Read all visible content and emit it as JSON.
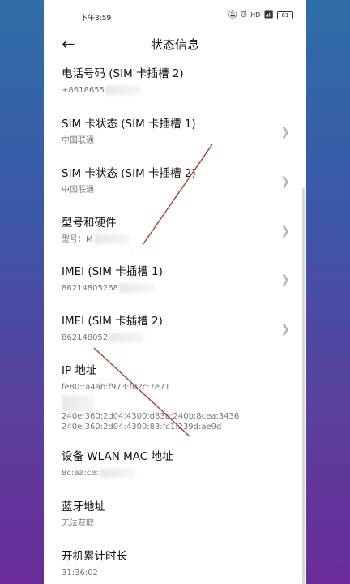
{
  "status_bar": {
    "time": "下午3:59",
    "icons": [
      "mute-icon",
      "alarm-icon",
      "hd-icon",
      "wifi-icon"
    ],
    "battery": "61"
  },
  "header": {
    "back_icon": "arrow-left-icon",
    "title": "状态信息"
  },
  "items": [
    {
      "label": "电话号码 (SIM 卡插槽 2)",
      "value": "+8618655",
      "chevron": false
    },
    {
      "label": "SIM 卡状态 (SIM 卡插槽 1)",
      "value": "中国联通",
      "chevron": true
    },
    {
      "label": "SIM 卡状态 (SIM 卡插槽 2)",
      "value": "中国联通",
      "chevron": true
    },
    {
      "label": "型号和硬件",
      "value": "型号：M",
      "chevron": true
    },
    {
      "label": "IMEI (SIM 卡插槽 1)",
      "value": "86214805268",
      "chevron": true
    },
    {
      "label": "IMEI (SIM 卡插槽 2)",
      "value": "862148052",
      "chevron": true
    },
    {
      "label": "IP 地址",
      "value_lines": [
        "fe80::a4ab:f973:f02c:7e71",
        "240e:360:2d04:4300:d83b:240b:8cea:3436",
        "240e:360:2d04:4300:83:fc1:239d:ae9d"
      ],
      "chevron": false
    },
    {
      "label": "设备 WLAN MAC 地址",
      "value": "8c:aa:ce:",
      "chevron": false
    },
    {
      "label": "蓝牙地址",
      "value": "无法获取",
      "chevron": false
    },
    {
      "label": "开机累计时长",
      "value": "31:36:02",
      "chevron": false
    }
  ],
  "colors": {
    "annotation": "#c0392b",
    "accent_bg_top": "#2f6ea8",
    "accent_bg_bottom": "#6a2c98"
  }
}
